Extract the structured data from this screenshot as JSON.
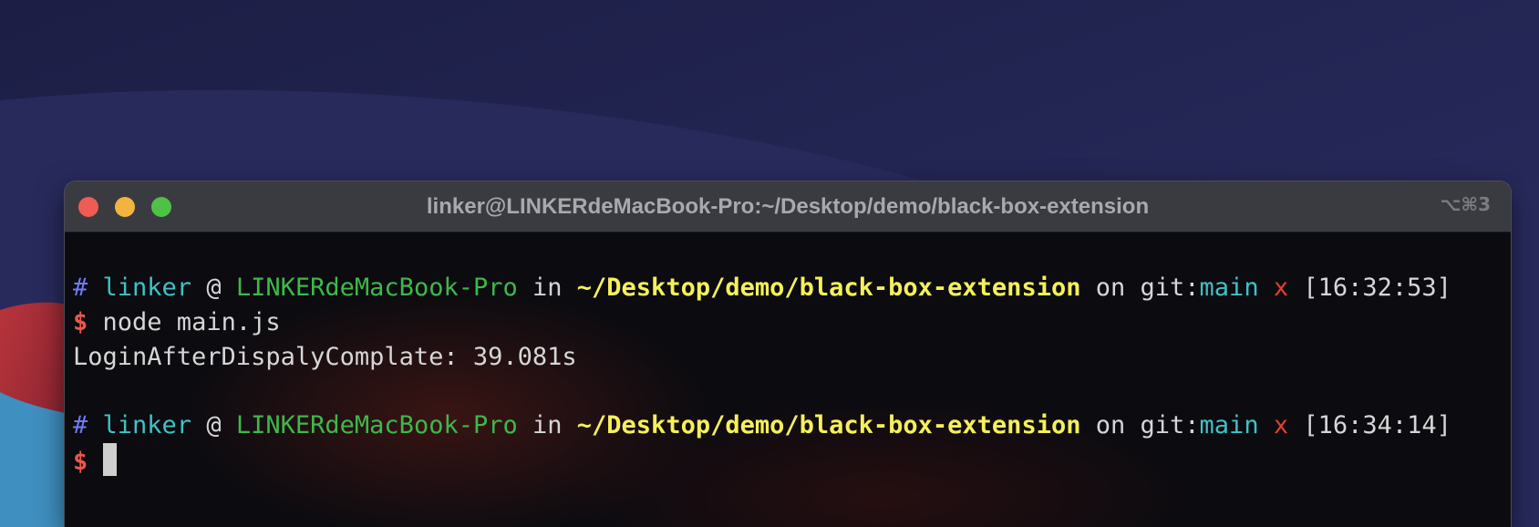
{
  "window": {
    "title": "linker@LINKERdeMacBook-Pro:~/Desktop/demo/black-box-extension",
    "shortcut": "⌥⌘3"
  },
  "colors": {
    "desktop_background": "#232552",
    "terminal_background": "#0b0b10",
    "hash": "#6f7cf2",
    "user": "#3fc2c6",
    "host": "#3eb84a",
    "path": "#f5f05a",
    "dirty": "#e3412c",
    "dollar": "#e8574e"
  },
  "terminal": {
    "prompts": [
      {
        "hash": "#",
        "user": "linker",
        "at": "@",
        "host": "LINKERdeMacBook-Pro",
        "in": "in",
        "path": "~/Desktop/demo/black-box-extension",
        "on": "on",
        "git_prefix": "git:",
        "branch": "main",
        "dirty": "x",
        "time": "[16:32:53]",
        "dollar": "$",
        "command": "node main.js"
      },
      {
        "hash": "#",
        "user": "linker",
        "at": "@",
        "host": "LINKERdeMacBook-Pro",
        "in": "in",
        "path": "~/Desktop/demo/black-box-extension",
        "on": "on",
        "git_prefix": "git:",
        "branch": "main",
        "dirty": "x",
        "time": "[16:34:14]",
        "dollar": "$",
        "command": ""
      }
    ],
    "output": "LoginAfterDispalyComplate: 39.081s"
  }
}
